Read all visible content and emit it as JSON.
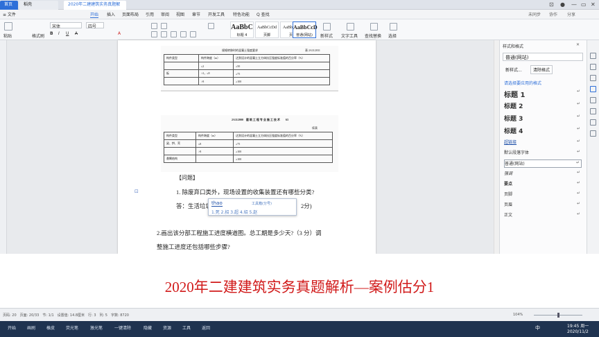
{
  "titlebar": {
    "tabs": [
      "首页",
      "稻壳",
      "2020年二建建筑实务真题解析.docx"
    ],
    "right": [
      "⊡",
      "▭",
      "—",
      "✕"
    ]
  },
  "menubar": {
    "left": [
      "≡ 文件",
      "开始",
      "插入",
      "页面布局",
      "引用",
      "审阅",
      "视图",
      "章节",
      "开发工具",
      "特色功能",
      "Q 查找"
    ],
    "active_index": 1,
    "right": [
      "未同步",
      "协作",
      "分享"
    ]
  },
  "ribbon": {
    "paste": "粘贴",
    "format_painter": "格式刷",
    "font_name": "宋体",
    "font_size": "四号",
    "styles": [
      {
        "preview": "AaBbC",
        "name": "标题 4"
      },
      {
        "preview": "AaBbCcDd",
        "name": "页脚"
      },
      {
        "preview": "AaBbCcDd",
        "name": "页眉"
      },
      {
        "preview": "AaBbCcD",
        "name": "普通(网站)"
      }
    ],
    "new_style": "新样式",
    "text_tools": "文字工具",
    "find_replace": "查找替换",
    "select": "选择"
  },
  "document": {
    "table1_title": "规格转移时的混凝土强度要求",
    "table1_code": "表 2A312031",
    "table1_header": [
      "构件类型",
      "构件跨度（m）",
      "达到设计的混凝土立方体抗压强度标准值的百分率（%）"
    ],
    "table1_rows": [
      [
        "",
        "≤2",
        "≥50"
      ],
      [
        "板",
        ">2，≤8",
        "≥75"
      ],
      [
        "",
        ">8",
        "≥100"
      ]
    ],
    "table2_header_line": "2A312000　建 筑 工 程 专 业 施 工 技 术　　63",
    "table2_cont": "续表",
    "table2_header": [
      "构件类型",
      "构件跨度（m）",
      "达到设计的混凝土立方体抗压强度标准值的百分率（%）"
    ],
    "table2_rows": [
      [
        "梁、拱、壳",
        "≤8",
        "≥75"
      ],
      [
        "",
        ">8",
        "≥100"
      ],
      [
        "悬臂结构",
        "",
        "≥100"
      ]
    ],
    "section_label": "【问题】",
    "q1": "1. 除废弃口类外，现场设置的收集装置还有哪些分类?",
    "a1": "答：生活垃圾",
    "a1_tail": "2分)",
    "q2": "2.画出该分部工程施工进度横道图。总工期是多少天?（3 分）调",
    "q2b": "整施工进度还包括哪些步骤?"
  },
  "ime": {
    "input": "thao",
    "hint": "工具箱(分号)",
    "candidates": "1.死  2.招  3.超  4.绍  5.赵"
  },
  "style_panel": {
    "title": "样式和格式",
    "current": "普通(网站)",
    "new_style": "新样式...",
    "clear_format": "清除格式",
    "apply_label": "请选择要应用的格式",
    "items": [
      {
        "name": "标题 1",
        "weight": "bold",
        "size": 10
      },
      {
        "name": "标题 2",
        "weight": "bold",
        "size": 9
      },
      {
        "name": "标题 3",
        "weight": "bold",
        "size": 9
      },
      {
        "name": "标题 4",
        "weight": "bold",
        "size": 9
      },
      {
        "name": "超链接",
        "weight": "normal",
        "size": 6
      },
      {
        "name": "默认段落字体",
        "weight": "normal",
        "size": 6
      },
      {
        "name": "普通(网站)",
        "weight": "normal",
        "size": 6
      },
      {
        "name": "强调",
        "weight": "normal",
        "size": 6
      },
      {
        "name": "要点",
        "weight": "normal",
        "size": 6
      },
      {
        "name": "页脚",
        "weight": "normal",
        "size": 6
      },
      {
        "name": "页眉",
        "weight": "normal",
        "size": 6
      },
      {
        "name": "正文",
        "weight": "normal",
        "size": 6
      }
    ]
  },
  "caption": "2020年二建建筑实务真题解析—案例估分1",
  "statusbar": {
    "left": "页码: 20　页面: 20/33　节: 1/1　设置值: 14.8厘米　行: 3　列: 5　字数: 8720",
    "zoom": "104%"
  },
  "taskbar": {
    "items": [
      "开始",
      "画刷",
      "橡皮",
      "荧光笔",
      "激光笔",
      "一键清除",
      "隐藏",
      "资源",
      "工具",
      "返回"
    ],
    "time": "19:45 周一",
    "date": "2020/11/2",
    "lang": "中"
  }
}
